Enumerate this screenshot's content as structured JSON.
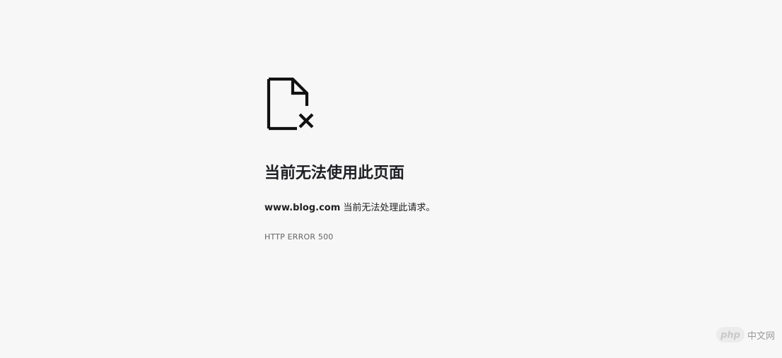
{
  "error_page": {
    "icon": "file-error-icon",
    "title": "当前无法使用此页面",
    "message": {
      "host": "www.blog.com",
      "text": " 当前无法处理此请求。"
    },
    "error_code": "HTTP ERROR 500"
  },
  "watermark": {
    "logo_text": "php",
    "site_text": "中文网"
  },
  "colors": {
    "background": "#f7f7f7",
    "text": "#202124",
    "secondary_text": "#646464",
    "icon": "#111111"
  }
}
